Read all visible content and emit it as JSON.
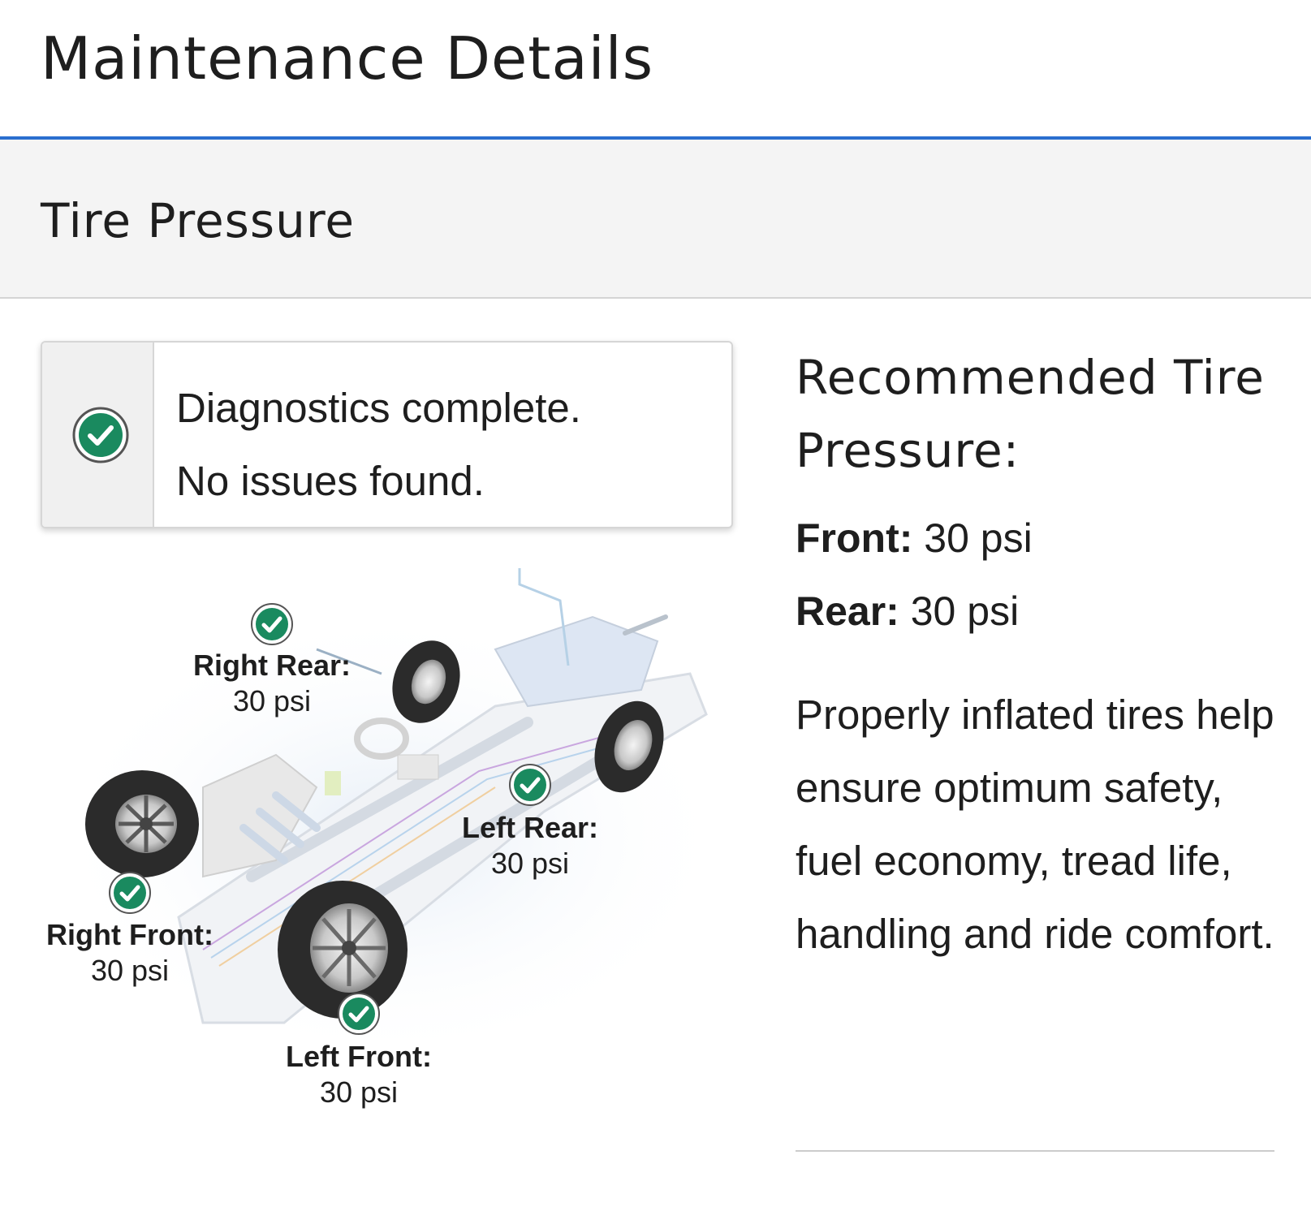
{
  "header": {
    "title": "Maintenance Details"
  },
  "section": {
    "title": "Tire Pressure"
  },
  "diagnostics": {
    "icon": "check-circle-icon",
    "line1": "Diagnostics complete.",
    "line2": "No issues found."
  },
  "tires": [
    {
      "name": "Right Rear:",
      "value": "30 psi",
      "status": "ok"
    },
    {
      "name": "Left Rear:",
      "value": "30 psi",
      "status": "ok"
    },
    {
      "name": "Right Front:",
      "value": "30 psi",
      "status": "ok"
    },
    {
      "name": "Left Front:",
      "value": "30 psi",
      "status": "ok"
    }
  ],
  "recommended": {
    "title": "Recommended Tire Pressure:",
    "front_label": "Front:",
    "front_value": "30 psi",
    "rear_label": "Rear:",
    "rear_value": "30 psi"
  },
  "description": "Properly inflated tires help ensure optimum safety, fuel economy, tread life, handling and ride comfort.",
  "colors": {
    "accent": "#2a6fcf",
    "ok": "#1a8a5f"
  }
}
